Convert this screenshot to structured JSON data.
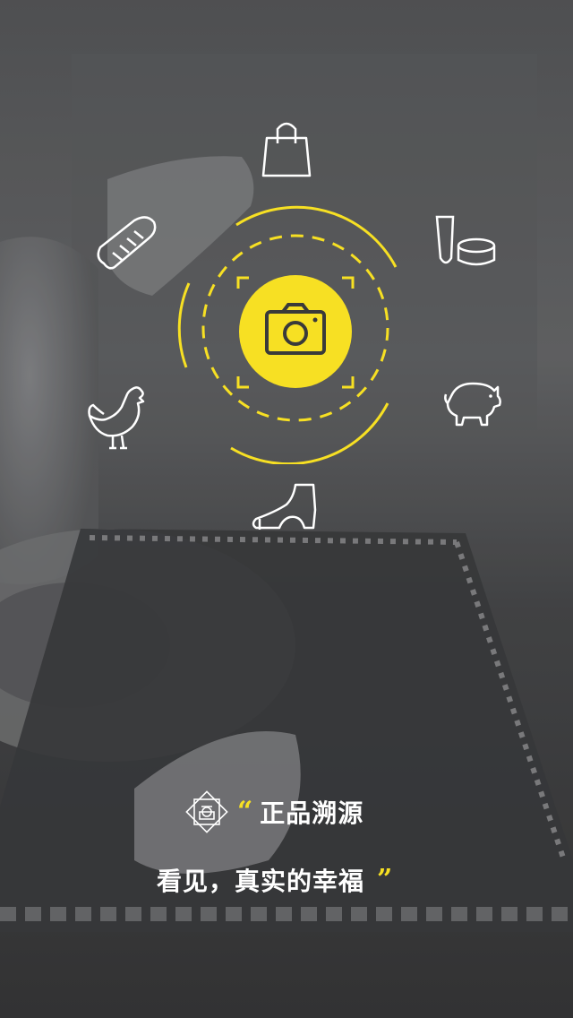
{
  "accent_color": "#f7e023",
  "center_icon": "camera-icon",
  "category_icons": [
    "shopping-bag-icon",
    "bread-icon",
    "cosmetics-icon",
    "chicken-icon",
    "pig-icon",
    "high-heel-shoe-icon"
  ],
  "brand": {
    "logo_icon": "geometric-logo-icon"
  },
  "tagline": {
    "open_quote": "“",
    "line1": "正品溯源",
    "line2": "看见，真实的幸福",
    "close_quote": "”"
  }
}
